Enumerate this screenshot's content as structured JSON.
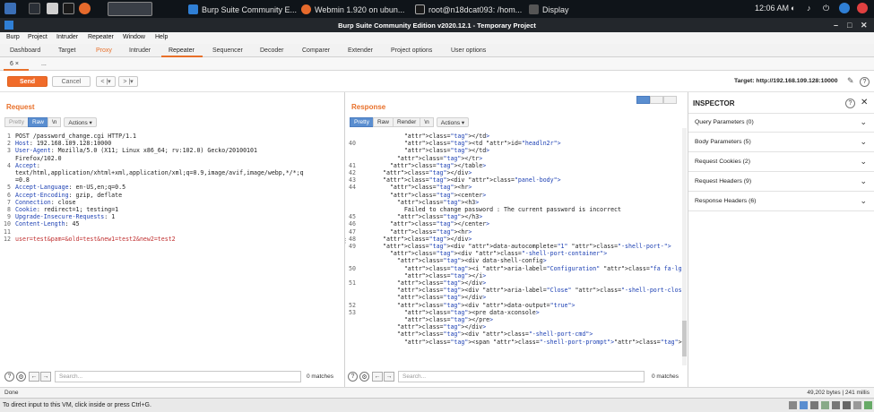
{
  "os_taskbar": {
    "apps": [
      {
        "label": "Burp Suite Community E..."
      },
      {
        "label": "Webmin 1.920 on ubun..."
      },
      {
        "label": "root@n18dcat093: /hom..."
      },
      {
        "label": "Display"
      }
    ],
    "clock": "12:06 AM"
  },
  "window": {
    "title": "Burp Suite Community Edition v2020.12.1 - Temporary Project"
  },
  "menu": [
    "Burp",
    "Project",
    "Intruder",
    "Repeater",
    "Window",
    "Help"
  ],
  "tabs": [
    "Dashboard",
    "Target",
    "Proxy",
    "Intruder",
    "Repeater",
    "Sequencer",
    "Decoder",
    "Comparer",
    "Extender",
    "Project options",
    "User options"
  ],
  "subtabs": {
    "current": "6 ×",
    "more": "..."
  },
  "toolbar": {
    "send": "Send",
    "cancel": "Cancel",
    "back": "< |▾",
    "forward": "> |▾",
    "target": "Target: http://192.168.109.128:10000"
  },
  "request": {
    "title": "Request",
    "views": [
      "Pretty",
      "Raw",
      "\\n",
      "Actions ▾"
    ],
    "line_numbers": "1\n2\n3\n\n4\n\n\n5\n6\n7\n8\n9\n10\n11\n12",
    "header_lines": [
      {
        "key": "",
        "text": "POST /password_change.cgi HTTP/1.1"
      },
      {
        "key": "Host",
        "text": ": 192.168.109.128:10000"
      },
      {
        "key": "User-Agent",
        "text": ": Mozilla/5.0 (X11; Linux x86_64; rv:102.0) Gecko/20100101"
      },
      {
        "key": "",
        "text": "Firefox/102.0"
      },
      {
        "key": "Accept",
        "text": ":"
      },
      {
        "key": "",
        "text": "text/html,application/xhtml+xml,application/xml;q=0.9,image/avif,image/webp,*/*;q"
      },
      {
        "key": "",
        "text": "=0.8"
      },
      {
        "key": "Accept-Language",
        "text": ": en-US,en;q=0.5"
      },
      {
        "key": "Accept-Encoding",
        "text": ": gzip, deflate"
      },
      {
        "key": "Connection",
        "text": ": close"
      },
      {
        "key": "Cookie",
        "text": ": redirect=1; testing=1"
      },
      {
        "key": "Upgrade-Insecure-Requests",
        "text": ": 1"
      },
      {
        "key": "Content-Length",
        "text": ": 45"
      },
      {
        "key": "",
        "text": ""
      },
      {
        "key": "",
        "text": "user=test&pam=&old=test&new1=test2&new2=test2"
      }
    ],
    "search_placeholder": "Search...",
    "matches": "0 matches"
  },
  "response": {
    "title": "Response",
    "views": [
      "Pretty",
      "Raw",
      "Render",
      "\\n",
      "Actions ▾"
    ],
    "line_numbers": "\n40\n\n\n41\n42\n43\n44\n\n\n\n45\n46\n47\n48\n49\n\n\n50\n\n51\n\n\n52\n53",
    "code": [
      "      </td>",
      "      <td id=\"headln2r\">",
      "      </td>",
      "    </tr>",
      "  </table>",
      "</div>",
      "<div class=\"panel-body\">",
      "  <hr>",
      "  <center>",
      "    <h3>",
      "      Failed to change password : The current password is incorrect",
      "    </h3>",
      "  </center>",
      "  <hr>",
      "</div>",
      "<div data-autocomplete=\"1\" class=\"-shell-port-\">",
      "  <div class=\"-shell-port-container\">",
      "    <div data-shell-config>",
      "      <i aria-label=\"Configuration\" class=\"fa fa-lg fa-cogs\">",
      "      </i>",
      "    </div>",
      "    <div aria-label=\"Close\" class=\"-shell-port-close\">",
      "    </div>",
      "    <div data-output=\"true\">",
      "      <pre data-xconsole>",
      "      </pre>",
      "    </div>",
      "    <div class=\"-shell-port-cmd\">",
      "      <span class=\"-shell-port-prompt\"><span class=\"-shell-port-type\">[@<"
    ],
    "search_placeholder": "Search...",
    "matches": "0 matches"
  },
  "inspector": {
    "title": "INSPECTOR",
    "sections": [
      "Query Parameters (0)",
      "Body Parameters (5)",
      "Request Cookies (2)",
      "Request Headers (9)",
      "Response Headers (6)"
    ]
  },
  "status": {
    "left": "Done",
    "right": "49,202 bytes | 241 millis"
  },
  "vm_hint": "To direct input to this VM, click inside or press Ctrl+G.",
  "colors": {
    "accent": "#e8702a",
    "selected_view": "#5a8ed0",
    "tag": "#1b3fb3",
    "attr": "#c03030"
  }
}
